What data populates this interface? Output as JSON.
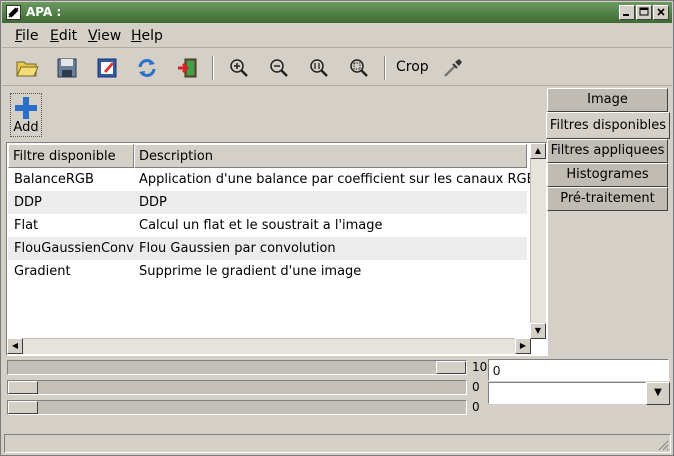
{
  "window": {
    "title": "APA :"
  },
  "window_buttons": {
    "minimize": "_",
    "maximize": "□",
    "close": "×"
  },
  "menu": [
    {
      "first": "F",
      "rest": "ile"
    },
    {
      "first": "E",
      "rest": "dit"
    },
    {
      "first": "V",
      "rest": "iew"
    },
    {
      "first": "H",
      "rest": "elp"
    }
  ],
  "toolbar": {
    "crop_label": "Crop",
    "icons": [
      "open-folder-icon",
      "save-icon",
      "edit-icon",
      "refresh-icon",
      "exit-icon",
      "zoom-in-icon",
      "zoom-out-icon",
      "zoom-fit-icon",
      "zoom-reset-icon",
      "eyedropper-icon"
    ]
  },
  "add_button": {
    "label": "Add"
  },
  "table": {
    "columns": [
      "Filtre disponible",
      "Description"
    ],
    "rows": [
      [
        "BalanceRGB",
        "Application d'une balance par coefficient sur les canaux RGB"
      ],
      [
        "DDP",
        "DDP"
      ],
      [
        "Flat",
        "Calcul un flat et le soustrait a l'image"
      ],
      [
        "FlouGaussienConv",
        "Flou Gaussien par convolution"
      ],
      [
        "Gradient",
        "Supprime le gradient d'une image"
      ]
    ]
  },
  "tabs": [
    "Image",
    "Filtres disponibles",
    "Filtres appliquees",
    "Histogrames",
    "Pré-traitement"
  ],
  "active_tab": 1,
  "sliders": [
    {
      "value_label": "10",
      "level": 1.0
    },
    {
      "value_label": "0",
      "level": 0.0
    },
    {
      "value_label": "0",
      "level": 0.0
    }
  ],
  "value_input": "0",
  "colors": {
    "titlebar": "#3d6b33",
    "face": "#d4d0c8",
    "alt_row": "#ececec"
  }
}
